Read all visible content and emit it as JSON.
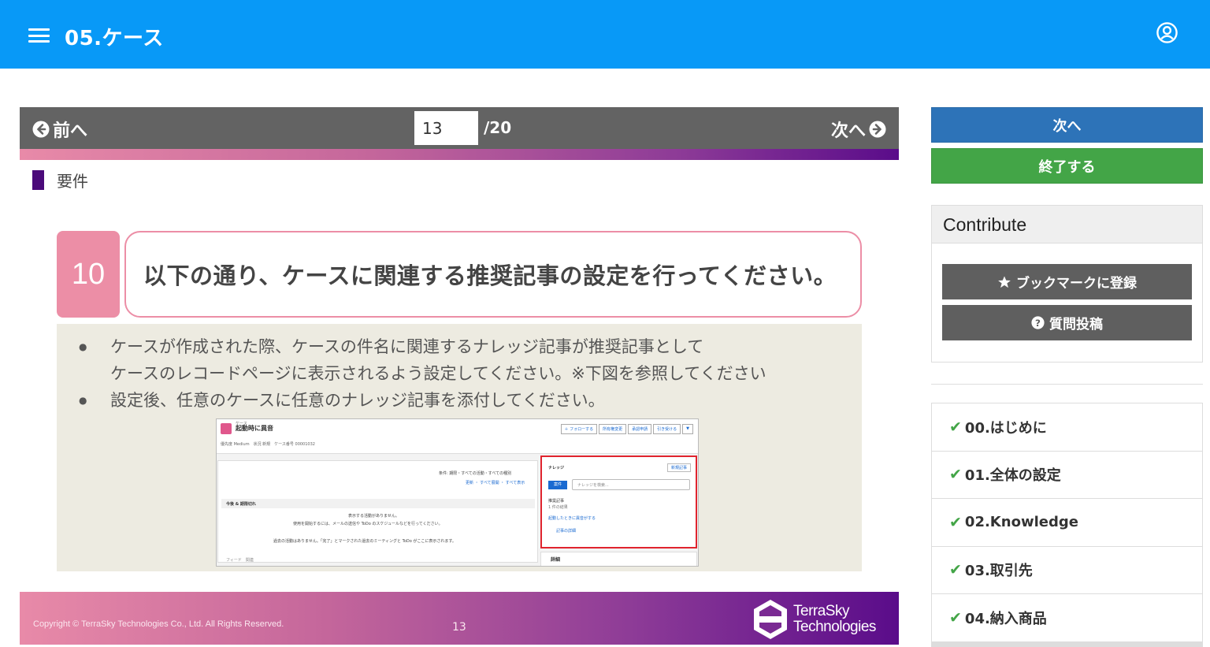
{
  "header": {
    "title": "05.ケース",
    "menu_icon": "menu-icon",
    "user_icon": "user-circle-icon"
  },
  "slide_nav": {
    "prev_label": "前へ",
    "next_label": "次へ",
    "current_page": "13",
    "total_pages": "/20"
  },
  "slide": {
    "section_label": "要件",
    "task_number": "10",
    "task_text": "以下の通り、ケースに関連する推奨記事の設定を行ってください。",
    "bullets": [
      "ケースが作成された際、ケースの件名に関連するナレッジ記事が推奨記事として",
      "ケースのレコードページに表示されるよう設定してください。※下図を参照してください",
      "設定後、任意のケースに任意のナレッジ記事を添付してください。"
    ],
    "screenshot": {
      "object_label": "ケース",
      "record_title": "起動時に異音",
      "buttons": [
        "＋ フォローする",
        "所有権変更",
        "承認申請",
        "引き受ける",
        "▼"
      ],
      "meta": "優先度 Medium　状況 新規　ケース番号 00001032",
      "filter_text": "条件: 期限・すべての活動・すべての種別",
      "links_text": "更新 ・ すべて展開 ・ すべて表示",
      "section_bar": "今後 & 期限切れ",
      "no_activity_1": "表示する活動がありません。",
      "no_activity_2": "使用を開始するには、メールの送信や ToDo のスケジュールなどを行ってください。",
      "past_activity": "過去の活動はありません。「完了」とマークされた過去のミーティングと ToDo がここに表示されます。",
      "bottom_tabs": "フィード　関連",
      "knowledge_title": "ナレッジ",
      "new_article": "新規記事",
      "case_tab": "案件",
      "search_placeholder": "ナレッジを検索...",
      "recommended": "推奨記事",
      "result_count": "1 件の結果",
      "article_link": "起動したときに異音がする",
      "article_detail": "記事の詳細",
      "details_label": "詳細"
    },
    "copyright": "Copyright © TerraSky Technologies Co., Ltd. All Rights Reserved.",
    "footer_page": "13",
    "logo_line1": "TerraSky",
    "logo_line2": "Technologies"
  },
  "sidebar": {
    "next_button": "次へ",
    "finish_button": "終了する",
    "contribute_title": "Contribute",
    "bookmark_button": "ブックマークに登録",
    "question_button": "質問投稿",
    "toc": [
      {
        "label": "00.はじめに"
      },
      {
        "label": "01.全体の設定"
      },
      {
        "label": "02.Knowledge"
      },
      {
        "label": "03.取引先"
      },
      {
        "label": "04.納入商品"
      }
    ]
  },
  "colors": {
    "header": "#0899f7",
    "next_button": "#2d73b8",
    "finish_button": "#43a547",
    "accent_pink": "#ec8ea6",
    "accent_purple": "#5a0c8a"
  }
}
